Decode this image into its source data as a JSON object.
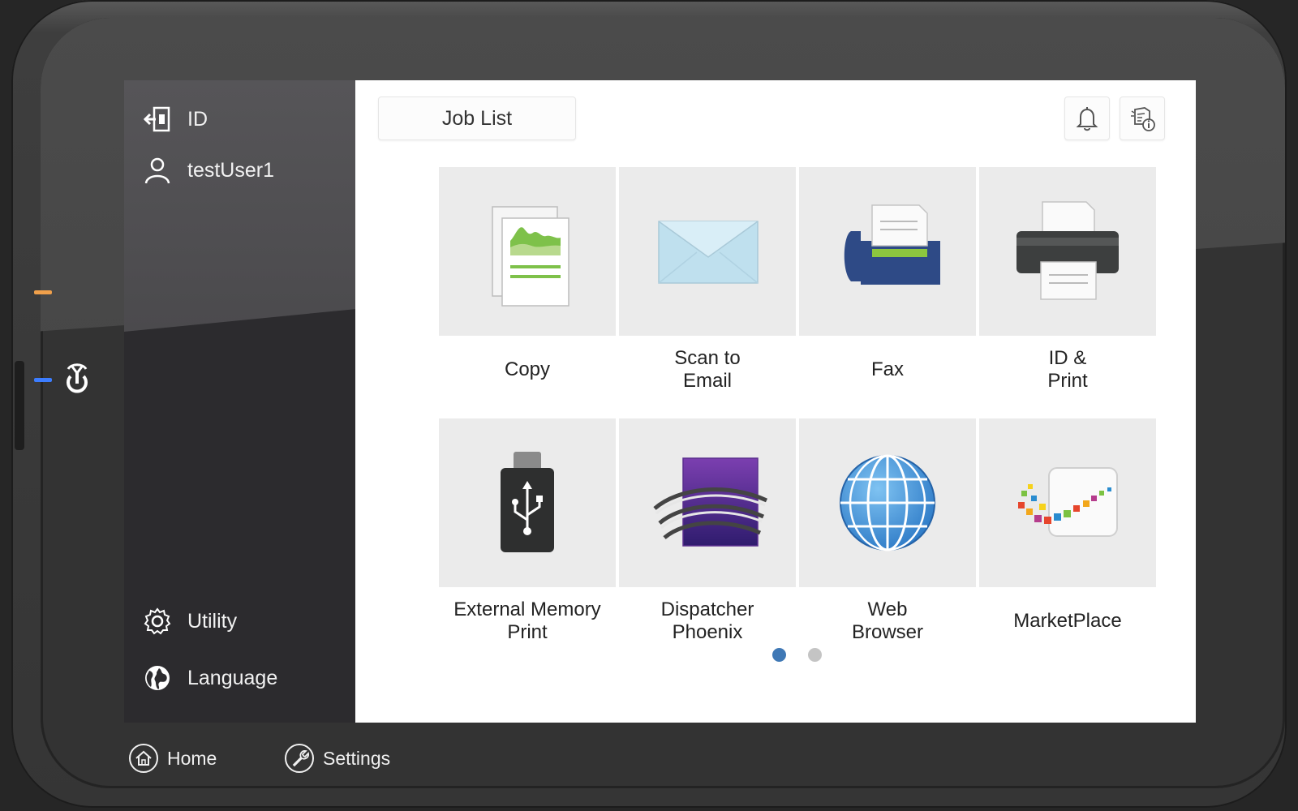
{
  "sidebar": {
    "id_label": "ID",
    "user_label": "testUser1",
    "utility_label": "Utility",
    "language_label": "Language"
  },
  "header": {
    "job_list_label": "Job List",
    "notification_icon": "bell-icon",
    "status_icon": "device-info-icon"
  },
  "tiles": [
    {
      "label": "Copy",
      "icon": "copy-icon"
    },
    {
      "label": "Scan to\nEmail",
      "icon": "envelope-icon"
    },
    {
      "label": "Fax",
      "icon": "fax-icon"
    },
    {
      "label": "ID &\nPrint",
      "icon": "printer-icon"
    },
    {
      "label": "External Memory\nPrint",
      "icon": "usb-icon"
    },
    {
      "label": "Dispatcher\nPhoenix",
      "icon": "dispatcher-phoenix-icon"
    },
    {
      "label": "Web\nBrowser",
      "icon": "globe-icon"
    },
    {
      "label": "MarketPlace",
      "icon": "marketplace-icon"
    }
  ],
  "pagination": {
    "current_page": 1,
    "total_pages": 2
  },
  "bottom_nav": {
    "home_label": "Home",
    "settings_label": "Settings"
  },
  "colors": {
    "active_dot": "#3f78b5",
    "inactive_dot": "#c4c4c4",
    "led_orange": "#f0a04b",
    "led_blue": "#3c7dff"
  }
}
